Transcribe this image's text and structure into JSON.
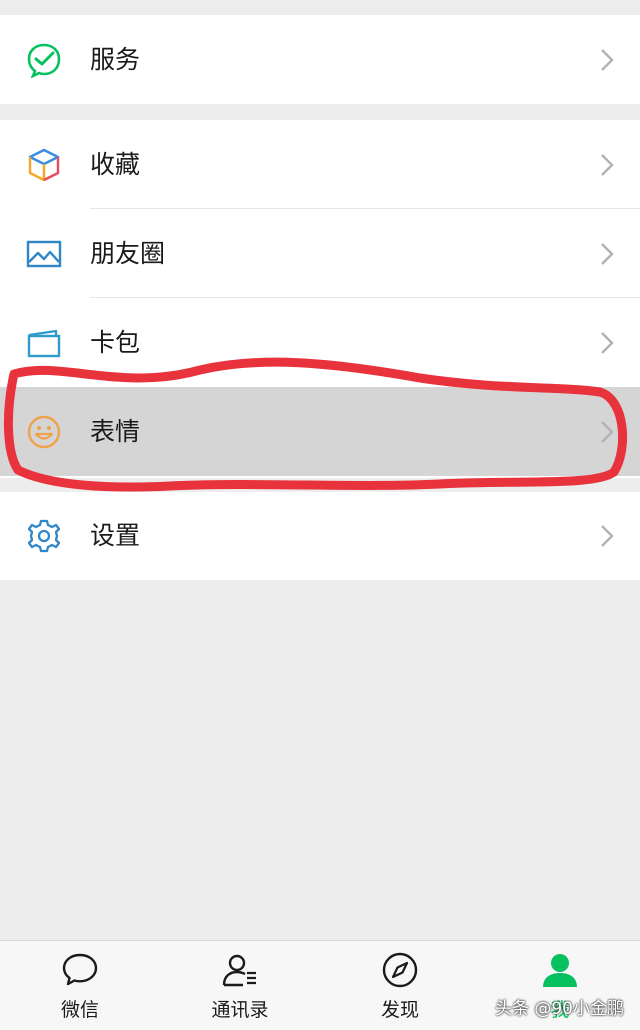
{
  "menu": {
    "services": {
      "label": "服务",
      "icon": "services-icon"
    },
    "favorites": {
      "label": "收藏",
      "icon": "favorites-cube-icon"
    },
    "moments": {
      "label": "朋友圈",
      "icon": "moments-image-icon"
    },
    "cards": {
      "label": "卡包",
      "icon": "card-wallet-icon"
    },
    "stickers": {
      "label": "表情",
      "icon": "smiley-icon",
      "state": "pressed"
    },
    "settings": {
      "label": "设置",
      "icon": "gear-icon"
    }
  },
  "tabbar": {
    "chats": {
      "label": "微信",
      "icon": "chat-bubble-icon"
    },
    "contacts": {
      "label": "通讯录",
      "icon": "contacts-icon"
    },
    "discover": {
      "label": "发现",
      "icon": "compass-icon"
    },
    "me": {
      "label": "我",
      "icon": "person-icon",
      "active": true
    }
  },
  "watermark": "头条 @90小金鹏",
  "colors": {
    "background": "#ededed",
    "row_pressed": "#d5d5d5",
    "accent_green": "#07c160",
    "annotation_red": "#e8323c"
  }
}
